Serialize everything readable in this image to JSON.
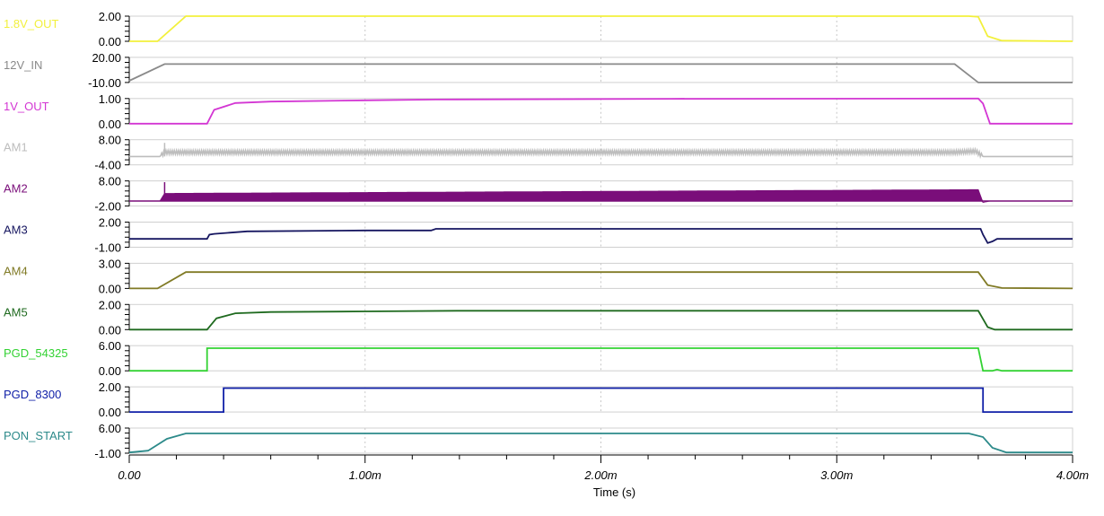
{
  "chart_data": {
    "type": "line",
    "xlabel": "Time (s)",
    "x_ticks": [
      "0.00",
      "1.00m",
      "2.00m",
      "3.00m",
      "4.00m"
    ],
    "x_tick_values": [
      0,
      0.001,
      0.002,
      0.003,
      0.004
    ],
    "xlim": [
      0,
      0.004
    ],
    "grid": true,
    "channels": [
      {
        "name": "1.8V_OUT",
        "color": "#f2f03c",
        "ylim": [
          0,
          2
        ],
        "tick_labels": [
          "2.00",
          "0.00"
        ],
        "points": [
          [
            0,
            0
          ],
          [
            0.00012,
            0
          ],
          [
            0.00024,
            2
          ],
          [
            0.00356,
            2
          ],
          [
            0.0036,
            1.95
          ],
          [
            0.00364,
            0.4
          ],
          [
            0.0037,
            0.05
          ],
          [
            0.004,
            0
          ]
        ]
      },
      {
        "name": "12V_IN",
        "color": "#8a8a8a",
        "ylim": [
          -10,
          20
        ],
        "tick_labels": [
          "20.00",
          "-10.00"
        ],
        "points": [
          [
            0,
            -8
          ],
          [
            0.00015,
            12
          ],
          [
            0.0035,
            12
          ],
          [
            0.0036,
            -10
          ],
          [
            0.004,
            -10
          ]
        ]
      },
      {
        "name": "1V_OUT",
        "color": "#d336d3",
        "ylim": [
          0,
          1
        ],
        "tick_labels": [
          "1.00",
          "0.00"
        ],
        "points": [
          [
            0,
            0
          ],
          [
            0.00033,
            0
          ],
          [
            0.00036,
            0.55
          ],
          [
            0.00045,
            0.82
          ],
          [
            0.0006,
            0.88
          ],
          [
            0.001,
            0.93
          ],
          [
            0.0013,
            0.96
          ],
          [
            0.0023,
            0.99
          ],
          [
            0.0036,
            1
          ],
          [
            0.00362,
            0.8
          ],
          [
            0.00365,
            0
          ],
          [
            0.004,
            0
          ]
        ]
      },
      {
        "name": "AM1",
        "color": "#bdbdbd",
        "ylim": [
          -4,
          8
        ],
        "tick_labels": [
          "8.00",
          "-4.00"
        ],
        "noise": true,
        "points": [
          [
            0,
            0
          ],
          [
            0.00013,
            0
          ],
          [
            0.00015,
            2
          ],
          [
            0.0035,
            2
          ],
          [
            0.00359,
            2.5
          ],
          [
            0.00362,
            0
          ],
          [
            0.004,
            0
          ]
        ]
      },
      {
        "name": "AM2",
        "color": "#7a0e7a",
        "ylim": [
          -2,
          8
        ],
        "tick_labels": [
          "8.00",
          "-2.00"
        ],
        "noise": true,
        "fill_band": true,
        "points": [
          [
            0,
            0
          ],
          [
            0.00013,
            0
          ],
          [
            0.00015,
            3
          ],
          [
            0.0036,
            4.5
          ],
          [
            0.00362,
            -0.5
          ],
          [
            0.00365,
            0
          ],
          [
            0.004,
            0
          ]
        ]
      },
      {
        "name": "AM3",
        "color": "#161660",
        "ylim": [
          -1,
          2
        ],
        "tick_labels": [
          "2.00",
          "-1.00"
        ],
        "points": [
          [
            0,
            0
          ],
          [
            0.00033,
            0
          ],
          [
            0.00034,
            0.5
          ],
          [
            0.00036,
            0.6
          ],
          [
            0.0005,
            0.9
          ],
          [
            0.001,
            1.0
          ],
          [
            0.00128,
            1.0
          ],
          [
            0.0013,
            1.2
          ],
          [
            0.00361,
            1.2
          ],
          [
            0.00362,
            0.5
          ],
          [
            0.00364,
            -0.5
          ],
          [
            0.00366,
            -0.3
          ],
          [
            0.00368,
            0
          ],
          [
            0.004,
            0
          ]
        ]
      },
      {
        "name": "AM4",
        "color": "#807a25",
        "ylim": [
          0,
          3
        ],
        "tick_labels": [
          "3.00",
          "0.00"
        ],
        "points": [
          [
            0,
            0
          ],
          [
            0.00012,
            0
          ],
          [
            0.00024,
            1.95
          ],
          [
            0.0036,
            1.95
          ],
          [
            0.00364,
            0.4
          ],
          [
            0.0037,
            0.05
          ],
          [
            0.004,
            0
          ]
        ]
      },
      {
        "name": "AM5",
        "color": "#1f6a1f",
        "ylim": [
          0,
          2
        ],
        "tick_labels": [
          "2.00",
          "0.00"
        ],
        "points": [
          [
            0,
            0
          ],
          [
            0.00033,
            0
          ],
          [
            0.00037,
            0.9
          ],
          [
            0.00045,
            1.3
          ],
          [
            0.0006,
            1.4
          ],
          [
            0.001,
            1.45
          ],
          [
            0.0014,
            1.5
          ],
          [
            0.0036,
            1.5
          ],
          [
            0.00364,
            0.2
          ],
          [
            0.00367,
            0
          ],
          [
            0.004,
            0
          ]
        ]
      },
      {
        "name": "PGD_54325",
        "color": "#33d233",
        "ylim": [
          0,
          6
        ],
        "tick_labels": [
          "6.00",
          "0.00"
        ],
        "points": [
          [
            0,
            0
          ],
          [
            0.00033,
            0
          ],
          [
            0.00033,
            5.4
          ],
          [
            0.0036,
            5.4
          ],
          [
            0.00362,
            0
          ],
          [
            0.00366,
            0
          ],
          [
            0.00368,
            0.3
          ],
          [
            0.0037,
            0
          ],
          [
            0.004,
            0
          ]
        ]
      },
      {
        "name": "PGD_8300",
        "color": "#1020a8",
        "ylim": [
          0,
          2
        ],
        "tick_labels": [
          "2.00",
          "0.00"
        ],
        "points": [
          [
            0,
            0
          ],
          [
            0.0004,
            0
          ],
          [
            0.0004,
            1.9
          ],
          [
            0.00362,
            1.9
          ],
          [
            0.00362,
            0
          ],
          [
            0.004,
            0
          ]
        ]
      },
      {
        "name": "PON_START",
        "color": "#2c8a8a",
        "ylim": [
          -1,
          6
        ],
        "tick_labels": [
          "6.00",
          "-1.00"
        ],
        "points": [
          [
            0,
            -0.8
          ],
          [
            8e-05,
            -0.3
          ],
          [
            0.00016,
            3
          ],
          [
            0.00024,
            4.5
          ],
          [
            0.00356,
            4.5
          ],
          [
            0.00362,
            3.5
          ],
          [
            0.00366,
            0.5
          ],
          [
            0.00372,
            -0.8
          ],
          [
            0.004,
            -0.8
          ]
        ]
      }
    ]
  }
}
